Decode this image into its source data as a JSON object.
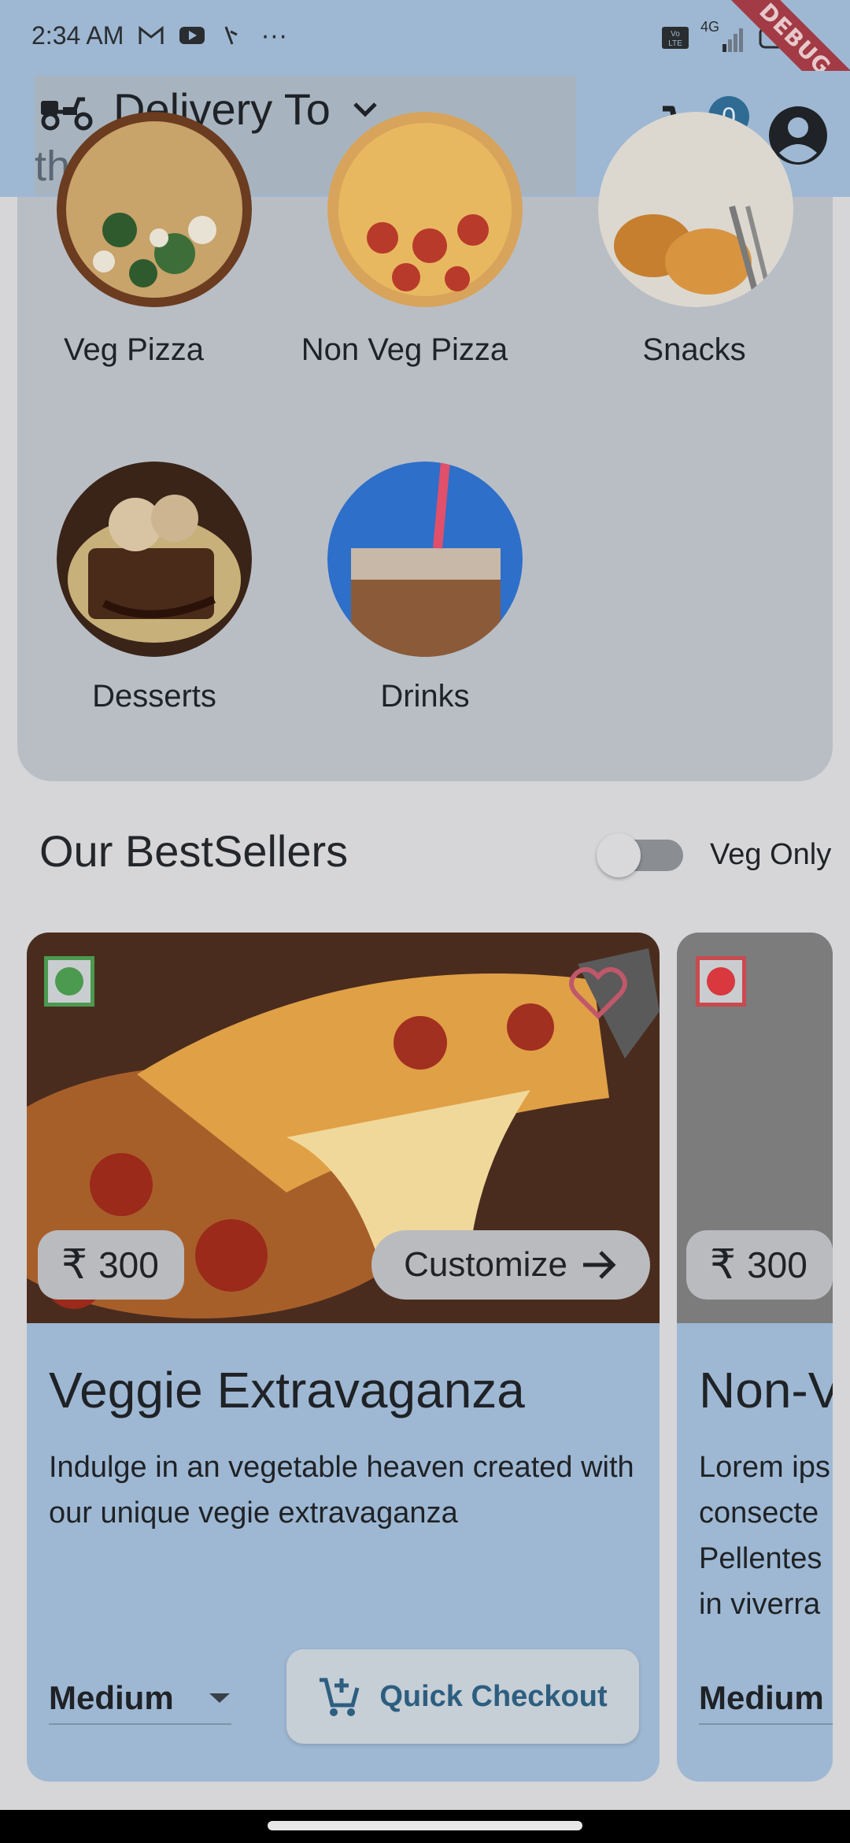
{
  "status_bar": {
    "time": "2:34 AM",
    "more": "···",
    "network": "4G",
    "debug_banner": "DEBUG"
  },
  "header": {
    "delivery_title": "Delivery To",
    "location": "thokkotu",
    "cart_count": "0"
  },
  "categories": [
    {
      "label": "Veg Pizza"
    },
    {
      "label": "Non Veg Pizza"
    },
    {
      "label": "Snacks"
    },
    {
      "label": "Desserts"
    },
    {
      "label": "Drinks"
    }
  ],
  "bestsellers": {
    "title": "Our BestSellers",
    "veg_only_label": "Veg Only",
    "veg_only_on": false
  },
  "products": [
    {
      "type": "veg",
      "currency": "₹",
      "price": "300",
      "customize_label": "Customize",
      "title": "Veggie Extravaganza",
      "description": "Indulge in an vegetable heaven created with our unique vegie extravaganza",
      "size": "Medium",
      "quick_checkout_label": "Quick Checkout"
    },
    {
      "type": "non-veg",
      "currency": "₹",
      "price": "300",
      "title": "Non-V",
      "description_lines": [
        "Lorem ips",
        "consecte",
        "Pellentes",
        "in viverra"
      ],
      "size": "Medium"
    }
  ],
  "colors": {
    "header_bg": "#9eb8d3",
    "card_bg": "#9eb8d3",
    "accent": "#2d5e80",
    "veg_green": "#4b9a4f",
    "nonveg_red": "#d8383e"
  }
}
